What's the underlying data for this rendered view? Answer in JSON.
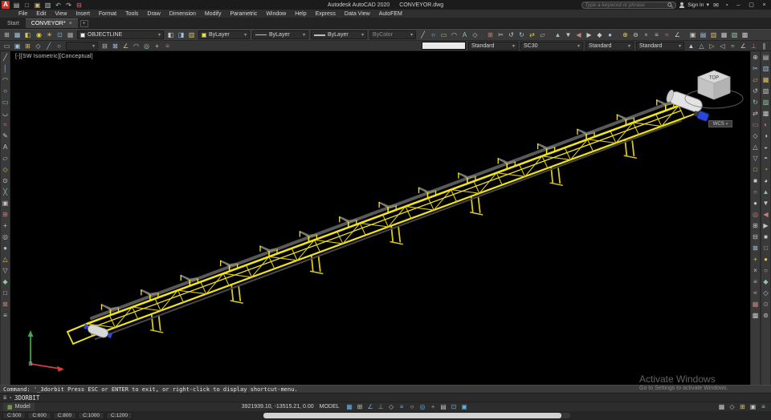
{
  "window": {
    "logo_letter": "A",
    "title_app": "Autodesk AutoCAD 2020",
    "title_file": "CONVEYOR.dwg",
    "search_placeholder": "Type a keyword or phrase",
    "sign_in": "Sign In"
  },
  "glyphs": {
    "caret": "▾",
    "close": "×",
    "minimize": "–",
    "maximize": "▢",
    "plus": "+",
    "cmd_icon": "≣",
    "grid": "▦"
  },
  "menu": {
    "items": [
      "File",
      "Edit",
      "View",
      "Insert",
      "Format",
      "Tools",
      "Draw",
      "Dimension",
      "Modify",
      "Parametric",
      "Window",
      "Help",
      "Express",
      "Data View",
      "AutoFEM"
    ]
  },
  "file_tabs": {
    "start": "Start",
    "active": "CONVEYOR*"
  },
  "toolbar": {
    "layer_value": "OBJECTLINE",
    "color_value": "ByLayer",
    "linetype_value": "ByLayer",
    "lineweight_value": "ByLayer",
    "plotstyle_value": "ByColor",
    "text_style": "Standard",
    "dim_style": "SC30",
    "table_style": "Standard",
    "mleader_style": "Standard",
    "swatch_color": "#e8e13a"
  },
  "strips": {
    "qat": "▤□▣▥↶↷⊟",
    "title_right": "✉◔",
    "row1_a": "⊞▦◧",
    "layer_tools": "◉☀⊡▦",
    "row1_b": "◧◨▥",
    "row1_c": "╱○▭◠A◇ ⊞✂↺↻⇄▱ ▲▼◀▶◆● ⊕⊖×≡≈∠ ▣▤▥▦▧▩",
    "row2_a": "▭▣⊞◇╱○",
    "row2_b": "⊟⊠∠◠◎+≡",
    "row2_c": "▲△▷◁≈∠⊥∥",
    "left_rail": "╱│◠○▭◡≈✎A▱◇⊙╳▣⊞+◎●△▽◆□⊠≡",
    "right_rail1": "⊕✂▱↺↻⇄▭◇△▽□■○●◎⊞⊟⊠+×≡≈▦▩",
    "right_rail2": "▤▥▦▧▨▩◐◑◒◓◔◕▲▼◀▶■□●○◆◇⊙⊚",
    "status_icons": "▦⊞∠⊥◇≡○◎+▤⊡▣",
    "status_right": "▦◇⊞▣≡"
  },
  "palettes": {
    "default": [
      "#c6c6c6",
      "#9fc4e0",
      "#d9c267",
      "#c6c6c6",
      "#8fc9a0",
      "#c6c6c6",
      "#c87f7f",
      "#c6c6c6"
    ],
    "layertools": [
      "#e8d13a",
      "#e8c33a",
      "#67b7e0",
      "#a8a8a8"
    ],
    "status": [
      "#63b0e3",
      "#c0c0c0",
      "#63b0e3",
      "#63b0e3",
      "#c0c0c0",
      "#63b0e3",
      "#c0c0c0",
      "#63b0e3"
    ]
  },
  "viewport": {
    "label": "[-][SW Isometric][Conceptual]",
    "viewcube_top": "TOP",
    "wcs_label": "WCS"
  },
  "command": {
    "history": "Command: '_3dorbit Press ESC or ENTER to exit, or right-click to display shortcut-menu.",
    "input": "3DORBIT"
  },
  "status": {
    "model_tab": "Model",
    "coords": "3921939.10, -13515.21, 0.00",
    "space": "MODEL"
  },
  "layout_tabs": {
    "items": [
      "C:500",
      "C:600",
      "C:800",
      "C:1000",
      "C:1200"
    ]
  },
  "watermark": {
    "line1": "Activate Windows",
    "line2": "Go to Settings to activate Windows."
  },
  "colors": {
    "accent_blue": "#0696d7",
    "cad_yellow": "#f2e41a",
    "canvas_bg": "#000000"
  }
}
